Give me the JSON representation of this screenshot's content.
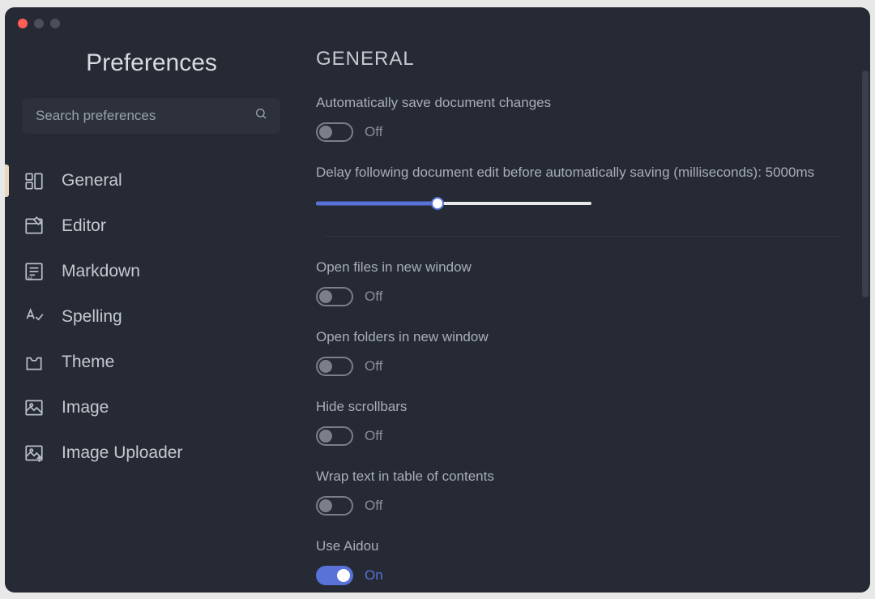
{
  "sidebar": {
    "title": "Preferences",
    "search_placeholder": "Search preferences",
    "items": [
      {
        "label": "General"
      },
      {
        "label": "Editor"
      },
      {
        "label": "Markdown"
      },
      {
        "label": "Spelling"
      },
      {
        "label": "Theme"
      },
      {
        "label": "Image"
      },
      {
        "label": "Image Uploader"
      }
    ]
  },
  "content": {
    "title": "GENERAL",
    "auto_save": {
      "label": "Automatically save document changes",
      "state": "Off"
    },
    "delay": {
      "label": "Delay following document edit before automatically saving (milliseconds): 5000ms",
      "value": 5000
    },
    "open_files": {
      "label": "Open files in new window",
      "state": "Off"
    },
    "open_folders": {
      "label": "Open folders in new window",
      "state": "Off"
    },
    "hide_scrollbars": {
      "label": "Hide scrollbars",
      "state": "Off"
    },
    "wrap_toc": {
      "label": "Wrap text in table of contents",
      "state": "Off"
    },
    "use_aidou": {
      "label": "Use Aidou",
      "state": "On"
    }
  }
}
